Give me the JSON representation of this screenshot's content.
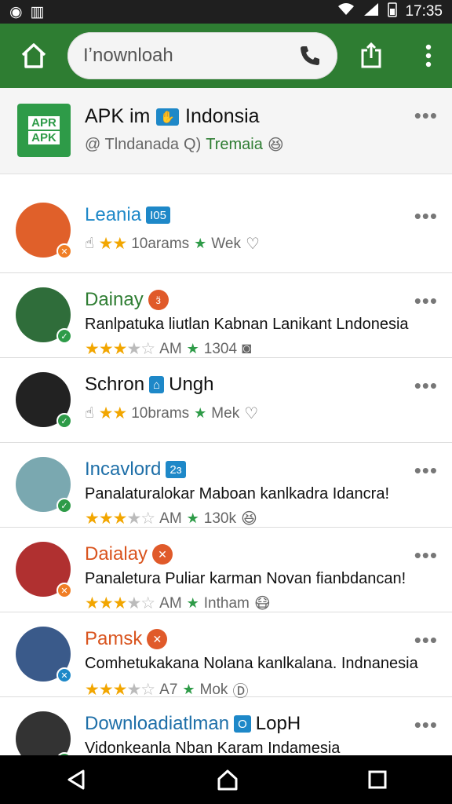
{
  "status": {
    "time": "17:35"
  },
  "search": {
    "value": "Iʼnownloah"
  },
  "header_card": {
    "logo_line1": "APR",
    "logo_line2": "APK",
    "title_pre": "APK im",
    "title_post": "Indonsia",
    "sub1": "@ Tlndanada",
    "sub2": "Q)",
    "sub3": "Tremaia",
    "emoji": "😆"
  },
  "list": [
    {
      "name": "Leania",
      "name_color": "#1e88c8",
      "tag": "I05",
      "tag_color": "#1e88c8",
      "tag_round": false,
      "desc": "",
      "stars_full": "★★",
      "stars_empty": "",
      "meta1": "10arams",
      "meta2": "Wek",
      "meta_icon": "♡",
      "avatar": "#e0602a",
      "badge": "#f07e25",
      "badge_glyph": "✕",
      "lead_icon": "☝"
    },
    {
      "name": "Dainay",
      "name_color": "#2e7d32",
      "tag": "ӟ",
      "tag_color": "#e05a2a",
      "tag_round": true,
      "desc": "Ranlpatuka liutlan Kabnan Lanikant Lndonesia",
      "stars_full": "★★★",
      "stars_empty": "★☆",
      "meta1": "AM",
      "meta2": "1304",
      "meta_icon": "◙",
      "avatar": "#2f6d3a",
      "badge": "#2e9b48",
      "badge_glyph": "✓",
      "lead_icon": ""
    },
    {
      "name": "Schron",
      "name_color": "#111111",
      "tag": "⌂",
      "tag_color": "#1e88c8",
      "tag_round": false,
      "name2": "Ungh",
      "desc": "",
      "stars_full": "★★",
      "stars_empty": "",
      "meta1": "10brams",
      "meta2": "Mek",
      "meta_icon": "♡",
      "avatar": "#222222",
      "badge": "#2e9b48",
      "badge_glyph": "✓",
      "lead_icon": "☝"
    },
    {
      "name": "Incavlord",
      "name_color": "#1e6fa8",
      "tag": "2ɜ",
      "tag_color": "#1e88c8",
      "tag_round": false,
      "desc": "Panalaturalokar Maboan kanlkadra Idancra!",
      "stars_full": "★★★",
      "stars_empty": "★☆",
      "meta1": "AM",
      "meta2": "130k",
      "meta_icon": "😆",
      "avatar": "#7aa8b0",
      "badge": "#2e9b48",
      "badge_glyph": "✓",
      "lead_icon": ""
    },
    {
      "name": "Daialay",
      "name_color": "#d9541e",
      "tag": "✕",
      "tag_color": "#e05a2a",
      "tag_round": true,
      "desc": "Panaletura Puliar karman Novan fianbdancan!",
      "stars_full": "★★★",
      "stars_empty": "★☆",
      "meta1": "AM",
      "meta2": "Intham",
      "meta_icon": "😷",
      "avatar": "#b03030",
      "badge": "#f07e25",
      "badge_glyph": "✕",
      "lead_icon": ""
    },
    {
      "name": "Pamsk",
      "name_color": "#d9541e",
      "tag": "✕",
      "tag_color": "#e05a2a",
      "tag_round": true,
      "desc": "Comhetukakana Nolana  kanlkalana. Indnanesia",
      "stars_full": "★★★",
      "stars_empty": "★☆",
      "meta1": "A7",
      "meta2": "Mok",
      "meta_icon": "Ⓓ",
      "avatar": "#3a5a8a",
      "badge": "#1e88c8",
      "badge_glyph": "✕",
      "lead_icon": ""
    },
    {
      "name": "Downloadiatlman",
      "name_color": "#1e6fa8",
      "tag": "O",
      "tag_color": "#1e88c8",
      "tag_round": false,
      "name2": "LopH",
      "desc": "Vidonkeanla Nban Karam Indamesia",
      "stars_full": "★★★★",
      "stars_empty": "",
      "meta1": "",
      "meta2": "",
      "meta_icon": "😄",
      "avatar": "#333333",
      "badge": "#2e9b48",
      "badge_glyph": "✓",
      "lead_icon": ""
    }
  ]
}
